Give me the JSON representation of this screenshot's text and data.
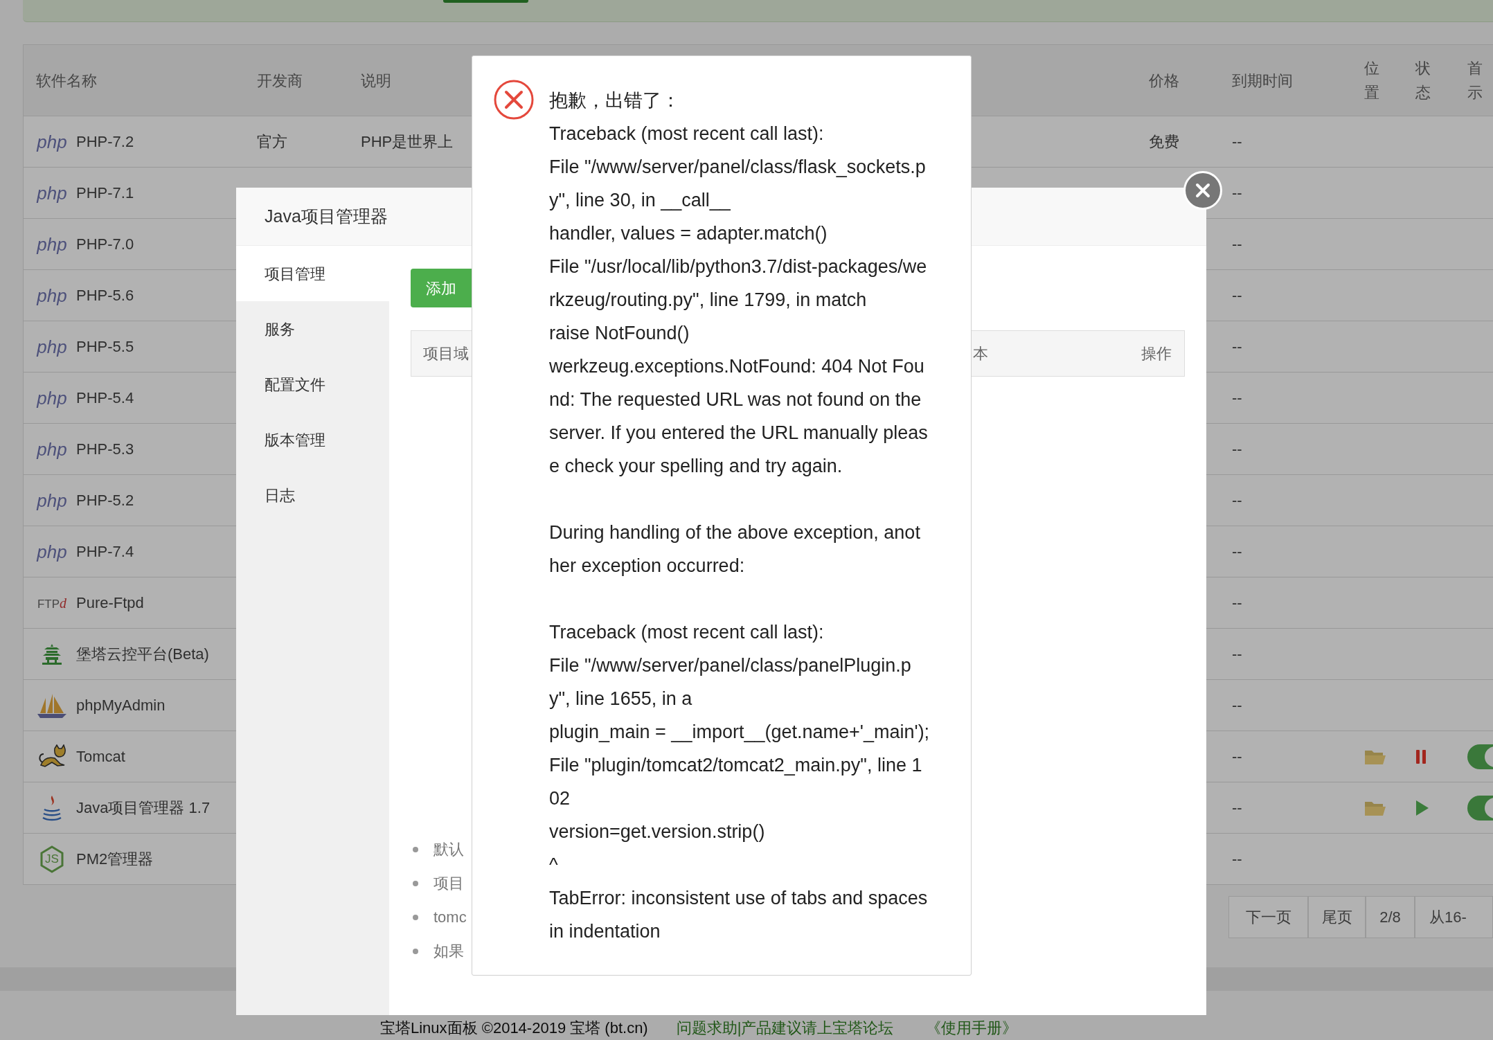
{
  "software_table": {
    "columns": [
      {
        "lines": [
          "软件名称"
        ]
      },
      {
        "lines": [
          "开发商"
        ]
      },
      {
        "lines": [
          "说明"
        ]
      },
      {
        "lines": [
          "价格"
        ]
      },
      {
        "lines": [
          "到期时间"
        ]
      },
      {
        "lines": [
          "位",
          "置"
        ]
      },
      {
        "lines": [
          "状",
          "态"
        ]
      },
      {
        "lines": [
          "首",
          "示"
        ]
      }
    ],
    "rows": [
      {
        "name": "PHP-7.2",
        "logo": {
          "kind": "php",
          "text": "php"
        },
        "developer": "官方",
        "description": "PHP是世界上",
        "price": "免费",
        "expiry": "--"
      },
      {
        "name": "PHP-7.1",
        "logo": {
          "kind": "php",
          "text": "php"
        },
        "expiry": "--"
      },
      {
        "name": "PHP-7.0",
        "logo": {
          "kind": "php",
          "text": "php"
        },
        "expiry": "--"
      },
      {
        "name": "PHP-5.6",
        "logo": {
          "kind": "php",
          "text": "php"
        },
        "expiry": "--"
      },
      {
        "name": "PHP-5.5",
        "logo": {
          "kind": "php",
          "text": "php"
        },
        "expiry": "--"
      },
      {
        "name": "PHP-5.4",
        "logo": {
          "kind": "php",
          "text": "php"
        },
        "expiry": "--"
      },
      {
        "name": "PHP-5.3",
        "logo": {
          "kind": "php",
          "text": "php"
        },
        "expiry": "--"
      },
      {
        "name": "PHP-5.2",
        "logo": {
          "kind": "php",
          "text": "php"
        },
        "expiry": "--"
      },
      {
        "name": "PHP-7.4",
        "logo": {
          "kind": "php",
          "text": "php"
        },
        "expiry": "--"
      },
      {
        "name": "Pure-Ftpd",
        "logo": {
          "kind": "ftp",
          "text": "FTP",
          "accent": "d"
        },
        "expiry": "--"
      },
      {
        "name": "堡塔云控平台(Beta)",
        "logo": {
          "kind": "pagoda"
        },
        "expiry": "--"
      },
      {
        "name": "phpMyAdmin",
        "logo": {
          "kind": "sailboat"
        },
        "expiry": "--"
      },
      {
        "name": "Tomcat",
        "logo": {
          "kind": "cat"
        },
        "expiry": "--",
        "controls": {
          "running": true,
          "on": true
        }
      },
      {
        "name": "Java项目管理器 1.7",
        "logo": {
          "kind": "cup"
        },
        "expiry": "--",
        "controls": {
          "running": false,
          "on": true
        }
      },
      {
        "name": "PM2管理器",
        "logo": {
          "kind": "hexagon",
          "text": "JS"
        },
        "expiry": "--"
      }
    ]
  },
  "pagination": [
    "下一页",
    "尾页",
    "2/8",
    "从16-"
  ],
  "footer": {
    "copyright": "宝塔Linux面板 ©2014-2019 宝塔 (bt.cn)",
    "links": [
      "问题求助|产品建议请上宝塔论坛",
      "《使用手册》"
    ]
  },
  "java_dialog": {
    "title": "Java项目管理器",
    "nav": [
      {
        "label": "项目管理",
        "selected": true
      },
      {
        "label": "服务",
        "selected": false
      },
      {
        "label": "配置文件",
        "selected": false
      },
      {
        "label": "版本管理",
        "selected": false
      },
      {
        "label": "日志",
        "selected": false
      }
    ],
    "add_button": "添加",
    "table_header": [
      "项目域",
      "本",
      "操作"
    ],
    "notes": [
      "默认",
      "项目",
      "tomc",
      "如果"
    ]
  },
  "error_dialog": {
    "title": "抱歉，出错了：",
    "blocks": [
      [
        "Traceback (most recent call last):",
        "File \"/www/server/panel/class/flask_sockets.p",
        "y\", line 30, in __call__",
        "handler, values = adapter.match()",
        "File \"/usr/local/lib/python3.7/dist-packages/we",
        "rkzeug/routing.py\", line 1799, in match",
        "raise NotFound()",
        "werkzeug.exceptions.NotFound: 404 Not Fou",
        "nd: The requested URL was not found on the",
        "server. If you entered the URL manually pleas",
        "e check your spelling and try again."
      ],
      [
        "During handling of the above exception, anot",
        "her exception occurred:"
      ],
      [
        "Traceback (most recent call last):",
        "File \"/www/server/panel/class/panelPlugin.p",
        "y\", line 1655, in a",
        "plugin_main = __import__(get.name+'_main');",
        "File \"plugin/tomcat2/tomcat2_main.py\", line 1",
        "02",
        "version=get.version.strip()",
        "^",
        "TabError: inconsistent use of tabs and spaces",
        "in indentation"
      ]
    ]
  }
}
